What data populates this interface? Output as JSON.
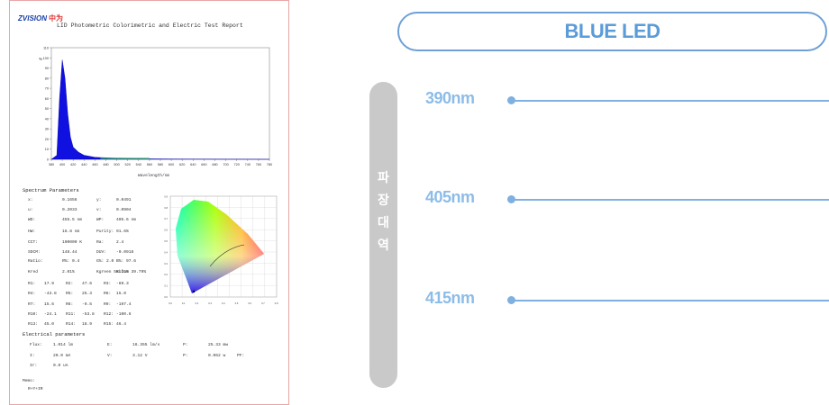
{
  "report": {
    "logo": "ZVISION",
    "logo_cn": "中为",
    "title": "LID Photometric Colorimetric and Electric Test Report",
    "wavelength_axis_label": "Wavelength/nm",
    "spectrum_section": "Spectrum Parameters",
    "rows": [
      [
        "x:",
        "0.1656",
        "y:",
        "0.0491"
      ],
      [
        "u:",
        "0.2033",
        "v:",
        "0.0904"
      ],
      [
        "WD:",
        "455.5 nm",
        "WP:",
        "405.6 nm"
      ],
      [
        "HW:",
        "16.8 nm",
        "Purity:",
        "91.6%"
      ],
      [
        "CCT:",
        "100000 K",
        "Ra:",
        "2.4"
      ],
      [
        "SDCM:",
        "148.44",
        "DUV:",
        "-0.0918"
      ],
      [
        "Ratio:",
        "R%: 0.4",
        "G%: 2.0",
        "B%: 97.6"
      ],
      [
        "Kred",
        "2.01%",
        "Kgreen 58.21%",
        "Kblue 39.79%"
      ],
      [
        "R1:",
        "17.9",
        "R2:",
        "47.6",
        "R3:",
        "-89.3"
      ],
      [
        "R4:",
        "-43.8",
        "R5:",
        "25.3",
        "R6:",
        "15.0"
      ],
      [
        "R7:",
        "15.6",
        "R8:",
        "-9.5",
        "R9:",
        "-197.4"
      ],
      [
        "R10:",
        "-24.1",
        "R11:",
        "-53.8",
        "R12:",
        "-100.6"
      ],
      [
        "R13:",
        "45.0",
        "R14:",
        "18.9",
        "R15:",
        "46.4"
      ]
    ],
    "electrical_section": "Electrical parameters",
    "elec_rows": [
      [
        "Flux:",
        "1.014 lm",
        "E:",
        "16.355 lm/s",
        "P:",
        "25.33 mw"
      ],
      [
        "I:",
        "20.0 mA",
        "V:",
        "3.12 V",
        "P:",
        "0.062 w",
        "PF:"
      ],
      [
        "Ir:",
        "0.0 uA"
      ]
    ],
    "memo_label": "Memo:",
    "memo_value": "R+Y+IR"
  },
  "chart_data": {
    "type": "area",
    "x": [
      380,
      390,
      395,
      400,
      405,
      410,
      415,
      420,
      430,
      440,
      450,
      460,
      480,
      500,
      520,
      540,
      560,
      600,
      700,
      780
    ],
    "values": [
      0,
      4,
      60,
      98,
      80,
      45,
      22,
      12,
      7,
      4,
      3,
      2,
      1.5,
      1,
      0.8,
      0.6,
      0.5,
      0.3,
      0.1,
      0
    ],
    "xlim": [
      380,
      780
    ],
    "ylim": [
      0,
      110
    ],
    "xticks": [
      "380",
      "400",
      "420",
      "440",
      "460",
      "480",
      "500",
      "520",
      "540",
      "560",
      "580",
      "600",
      "620",
      "640",
      "660",
      "680",
      "700",
      "720",
      "740",
      "760",
      "780"
    ],
    "yticks": [
      "0",
      "10",
      "20",
      "30",
      "40",
      "50",
      "60",
      "70",
      "80",
      "90",
      "100",
      "110"
    ],
    "ylabel": "%",
    "xlabel": "Wavelength/nm",
    "fill_color": "#1010e0"
  },
  "panel": {
    "title": "BLUE LED",
    "vertical_label": [
      "파",
      "장",
      "대",
      "역"
    ],
    "wavelengths": [
      "390nm",
      "405nm",
      "415nm"
    ],
    "accent": "#5b9bd8",
    "label_color": "#8cbce8",
    "pill_color": "#c9c9c9"
  }
}
